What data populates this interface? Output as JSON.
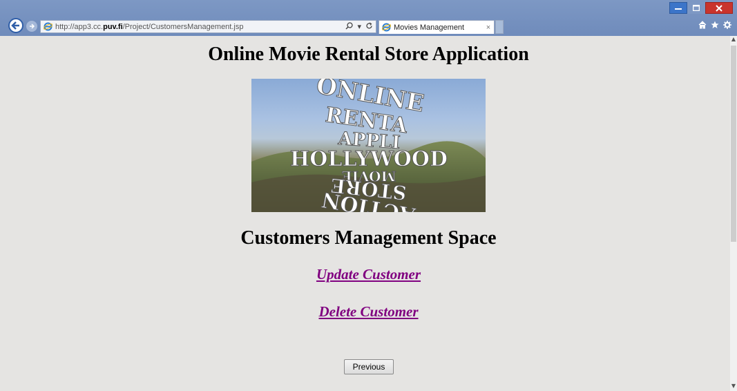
{
  "browser": {
    "url_prefix": "http://app3.cc.",
    "url_domain": "puv.fi",
    "url_path": "/Project/CustomersManagement.jsp",
    "search_icon": "search-icon",
    "refresh_icon": "refresh-icon",
    "tab_title": "Movies Management",
    "tab_close": "×",
    "window_controls": [
      "minimize-icon",
      "maximize-icon",
      "close-icon"
    ],
    "toolbar_icons": [
      "home-icon",
      "favorites-star-icon",
      "settings-gear-icon"
    ]
  },
  "page": {
    "title": "Online Movie Rental Store Application",
    "banner": {
      "words": [
        "ONLINE",
        "RENTA",
        "APPLI",
        "HOLLYWOOD",
        "MOVIE",
        "STORE",
        "ACTION"
      ]
    },
    "subtitle": "Customers Management Space",
    "links": {
      "update": "Update Customer",
      "delete": "Delete Customer"
    },
    "previous_label": "Previous"
  },
  "colors": {
    "link": "#800080",
    "titlebar": "#7d98c4",
    "background": "#e5e4e2"
  }
}
